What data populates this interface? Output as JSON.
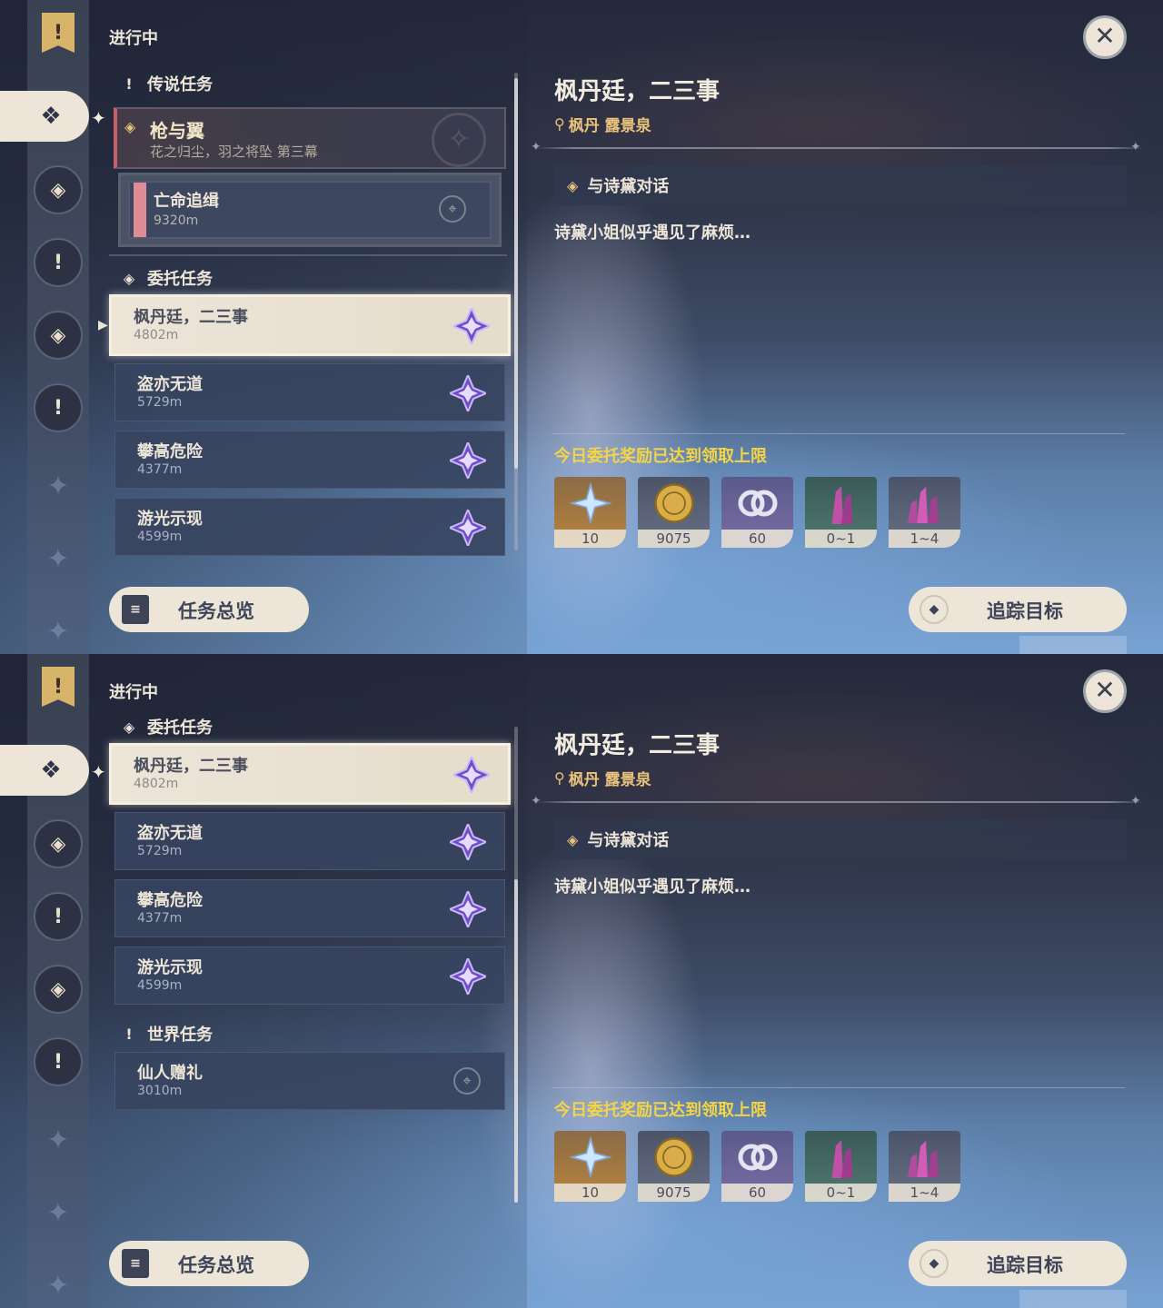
{
  "top": {
    "status": "进行中",
    "categories": {
      "legend": "传说任务",
      "commission": "委托任务"
    },
    "legend_quest": {
      "title": "枪与翼",
      "subtitle": "花之归尘，羽之将坠 第三幕"
    },
    "legend_subquest": {
      "title": "亡命追缉",
      "distance": "9320m"
    },
    "quests": [
      {
        "title": "枫丹廷，二三事",
        "distance": "4802m"
      },
      {
        "title": "盗亦无道",
        "distance": "5729m"
      },
      {
        "title": "攀高危险",
        "distance": "4377m"
      },
      {
        "title": "游光示现",
        "distance": "4599m"
      }
    ]
  },
  "bottom": {
    "status": "进行中",
    "categories": {
      "commission": "委托任务",
      "world": "世界任务"
    },
    "quests": [
      {
        "title": "枫丹廷，二三事",
        "distance": "4802m"
      },
      {
        "title": "盗亦无道",
        "distance": "5729m"
      },
      {
        "title": "攀高危险",
        "distance": "4377m"
      },
      {
        "title": "游光示现",
        "distance": "4599m"
      }
    ],
    "world_quest": {
      "title": "仙人赠礼",
      "distance": "3010m"
    }
  },
  "detail": {
    "title": "枫丹廷，二三事",
    "location": "枫丹 露景泉",
    "objective": "与诗黛对话",
    "description": "诗黛小姐似乎遇见了麻烦…",
    "reward_limit": "今日委托奖励已达到领取上限",
    "rewards": [
      {
        "icon": "primogem-icon",
        "count": "10"
      },
      {
        "icon": "mora-icon",
        "count": "9075"
      },
      {
        "icon": "fellowship-icon",
        "count": "60"
      },
      {
        "icon": "crystal-chunk-icon",
        "count": "0~1"
      },
      {
        "icon": "crystal-cluster-icon",
        "count": "1~4"
      }
    ]
  },
  "buttons": {
    "overview": "任务总览",
    "track": "追踪目标"
  },
  "colors": {
    "accent_gold": "#e8c27a",
    "limit_yellow": "#f5d544",
    "panel_light": "#ece5d8",
    "legend_red": "#c95f6a"
  }
}
